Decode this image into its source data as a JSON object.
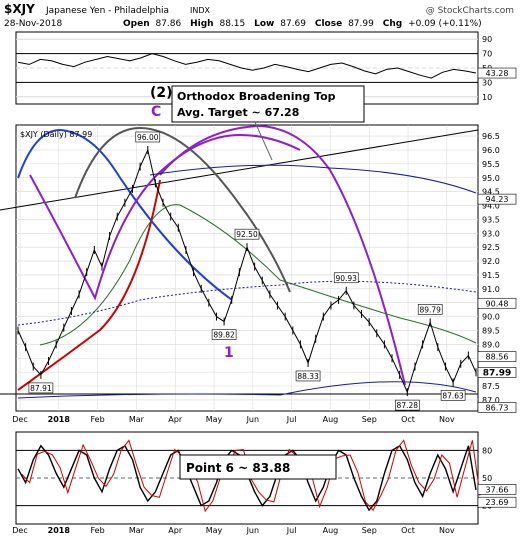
{
  "header": {
    "symbol": "$XJY",
    "name": "Japanese Yen - Philadelphia",
    "exchange": "INDX",
    "watermark": "@ StockCharts.com",
    "date": "28-Nov-2018",
    "open_label": "Open",
    "open": "87.86",
    "high_label": "High",
    "high": "88.15",
    "low_label": "Low",
    "low": "87.69",
    "close_label": "Close",
    "close": "87.99",
    "chg_label": "Chg",
    "chg": "+0.09 (+0.11%)"
  },
  "colors": {
    "frame": "#000000",
    "price": "#000000",
    "blue_arc": "#1f3fd8",
    "purple_arc": "#8c1fd0",
    "gray_arc": "#555555",
    "red_ma": "#cc0000",
    "green_ma": "#2b6e2b",
    "navy_band": "#1c1c8c",
    "grid": "#d8d8d8"
  },
  "chart_data": [
    {
      "type": "line",
      "panel": "rsi",
      "ylim": [
        0,
        100
      ],
      "y_ticks": [
        10,
        30,
        50,
        70,
        90
      ],
      "value_label": "43.28",
      "values": [
        58,
        55,
        62,
        60,
        55,
        52,
        58,
        62,
        66,
        63,
        60,
        64,
        70,
        66,
        60,
        55,
        58,
        62,
        60,
        55,
        50,
        47,
        50,
        55,
        52,
        48,
        45,
        50,
        55,
        57,
        52,
        46,
        42,
        48,
        50,
        45,
        40,
        36,
        44,
        48,
        46,
        43
      ]
    },
    {
      "type": "line",
      "panel": "price",
      "label": "$XJY (Daily) 87.99",
      "ylim": [
        86.6,
        96.9
      ],
      "y_ticks": [
        "87.0",
        "87.5",
        "88.0",
        "88.5",
        "89.0",
        "89.5",
        "90.0",
        "90.5",
        "91.0",
        "91.5",
        "92.0",
        "92.5",
        "93.0",
        "93.5",
        "94.0",
        "94.5",
        "95.0",
        "95.5",
        "96.0",
        "96.5"
      ],
      "x_ticks": [
        "Dec",
        "2018",
        "Feb",
        "Mar",
        "Apr",
        "May",
        "Jun",
        "Jul",
        "Aug",
        "Sep",
        "Oct",
        "Nov"
      ],
      "values": [
        89.5,
        88.9,
        88.2,
        87.9,
        88.4,
        89.0,
        89.6,
        90.2,
        90.8,
        91.6,
        92.4,
        91.8,
        92.9,
        93.6,
        94.1,
        94.6,
        95.4,
        96.0,
        94.8,
        94.1,
        93.6,
        93.2,
        92.4,
        91.6,
        91.0,
        90.5,
        90.0,
        89.82,
        90.6,
        91.6,
        92.5,
        91.8,
        91.3,
        90.8,
        90.4,
        90.0,
        89.5,
        89.0,
        88.33,
        89.2,
        90.0,
        90.4,
        90.6,
        90.93,
        90.4,
        90.1,
        89.8,
        89.4,
        89.0,
        88.5,
        87.9,
        87.28,
        88.2,
        89.0,
        89.79,
        88.9,
        88.2,
        87.63,
        88.3,
        88.6,
        87.99
      ],
      "price_labels": [
        {
          "text": "96.00",
          "point": 17
        },
        {
          "text": "92.50",
          "point": 30
        },
        {
          "text": "89.82",
          "point": 27
        },
        {
          "text": "88.33",
          "point": 38
        },
        {
          "text": "90.93",
          "point": 43
        },
        {
          "text": "89.79",
          "point": 54
        },
        {
          "text": "87.28",
          "point": 51
        },
        {
          "text": "87.63",
          "point": 57
        },
        {
          "text": "87.91",
          "point": 3
        }
      ],
      "right_labels": [
        "94.23",
        "90.48",
        "88.56",
        "87.99",
        "86.73"
      ]
    },
    {
      "type": "line",
      "panel": "stochastic",
      "ylim": [
        0,
        100
      ],
      "y_ticks": [
        20,
        50,
        80
      ],
      "value_labels": [
        "37.66",
        "23.69"
      ],
      "values": [
        60,
        45,
        70,
        85,
        75,
        55,
        40,
        60,
        80,
        75,
        50,
        35,
        60,
        80,
        85,
        70,
        40,
        25,
        35,
        55,
        75,
        80,
        60,
        40,
        20,
        25,
        45,
        70,
        80,
        75,
        55,
        35,
        20,
        30,
        55,
        75,
        80,
        70,
        45,
        25,
        40,
        65,
        80,
        75,
        50,
        30,
        15,
        25,
        55,
        80,
        85,
        70,
        45,
        30,
        55,
        75,
        60,
        35,
        60,
        85,
        37
      ]
    }
  ],
  "annotations": {
    "wave_2": "(2)",
    "wave_c": "C",
    "wave_1": "1",
    "broadening_line1": "Orthodox Broadening Top",
    "broadening_line2": "Avg. Target ~ 67.28",
    "point6": "Point 6 ~ 83.88"
  }
}
